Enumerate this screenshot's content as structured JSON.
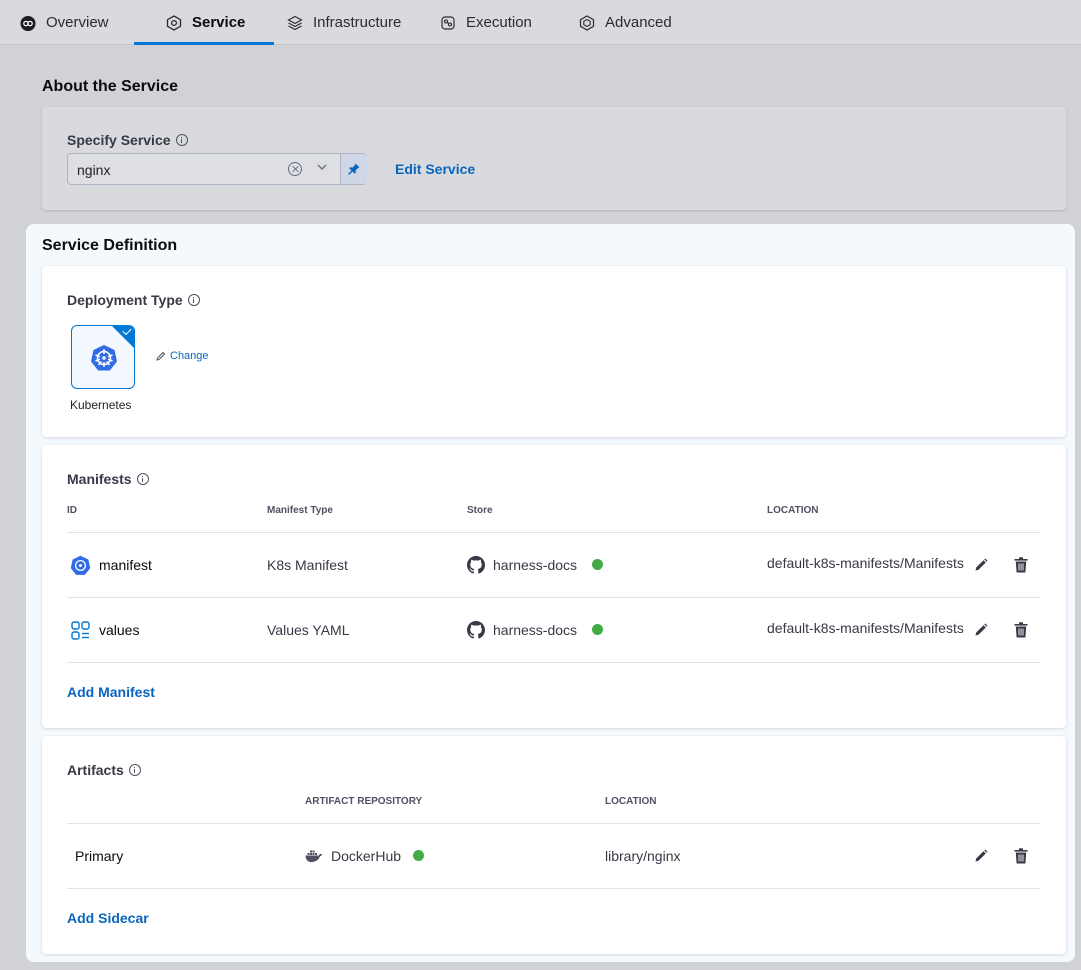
{
  "tabs": [
    {
      "label": "Overview",
      "icon": "pipeline-icon"
    },
    {
      "label": "Service",
      "icon": "service-icon"
    },
    {
      "label": "Infrastructure",
      "icon": "infrastructure-icon"
    },
    {
      "label": "Execution",
      "icon": "execution-icon"
    },
    {
      "label": "Advanced",
      "icon": "advanced-icon"
    }
  ],
  "active_tab": "Service",
  "about": {
    "title": "About the Service",
    "specify_label": "Specify Service",
    "service_value": "nginx",
    "edit_link": "Edit Service"
  },
  "definition": {
    "title": "Service Definition",
    "deployment": {
      "label": "Deployment Type",
      "selected": "Kubernetes",
      "change_link": "Change"
    },
    "manifests": {
      "title": "Manifests",
      "columns": [
        "ID",
        "Manifest Type",
        "Store",
        "LOCATION"
      ],
      "rows": [
        {
          "id": "manifest",
          "type": "K8s Manifest",
          "store": "harness-docs",
          "location": "default-k8s-manifests/Manifests",
          "icon": "kubernetes-icon",
          "status": "connected"
        },
        {
          "id": "values",
          "type": "Values YAML",
          "store": "harness-docs",
          "location": "default-k8s-manifests/Manifests",
          "icon": "values-yaml-icon",
          "status": "connected"
        }
      ],
      "add_link": "Add Manifest"
    },
    "artifacts": {
      "title": "Artifacts",
      "columns": [
        "ARTIFACT REPOSITORY",
        "LOCATION"
      ],
      "rows": [
        {
          "name": "Primary",
          "repository": "DockerHub",
          "location": "library/nginx",
          "status": "connected"
        }
      ],
      "add_link": "Add Sidecar"
    }
  },
  "colors": {
    "accent": "#0278d5",
    "link": "#0a65be",
    "status_ok": "#42ab45"
  }
}
